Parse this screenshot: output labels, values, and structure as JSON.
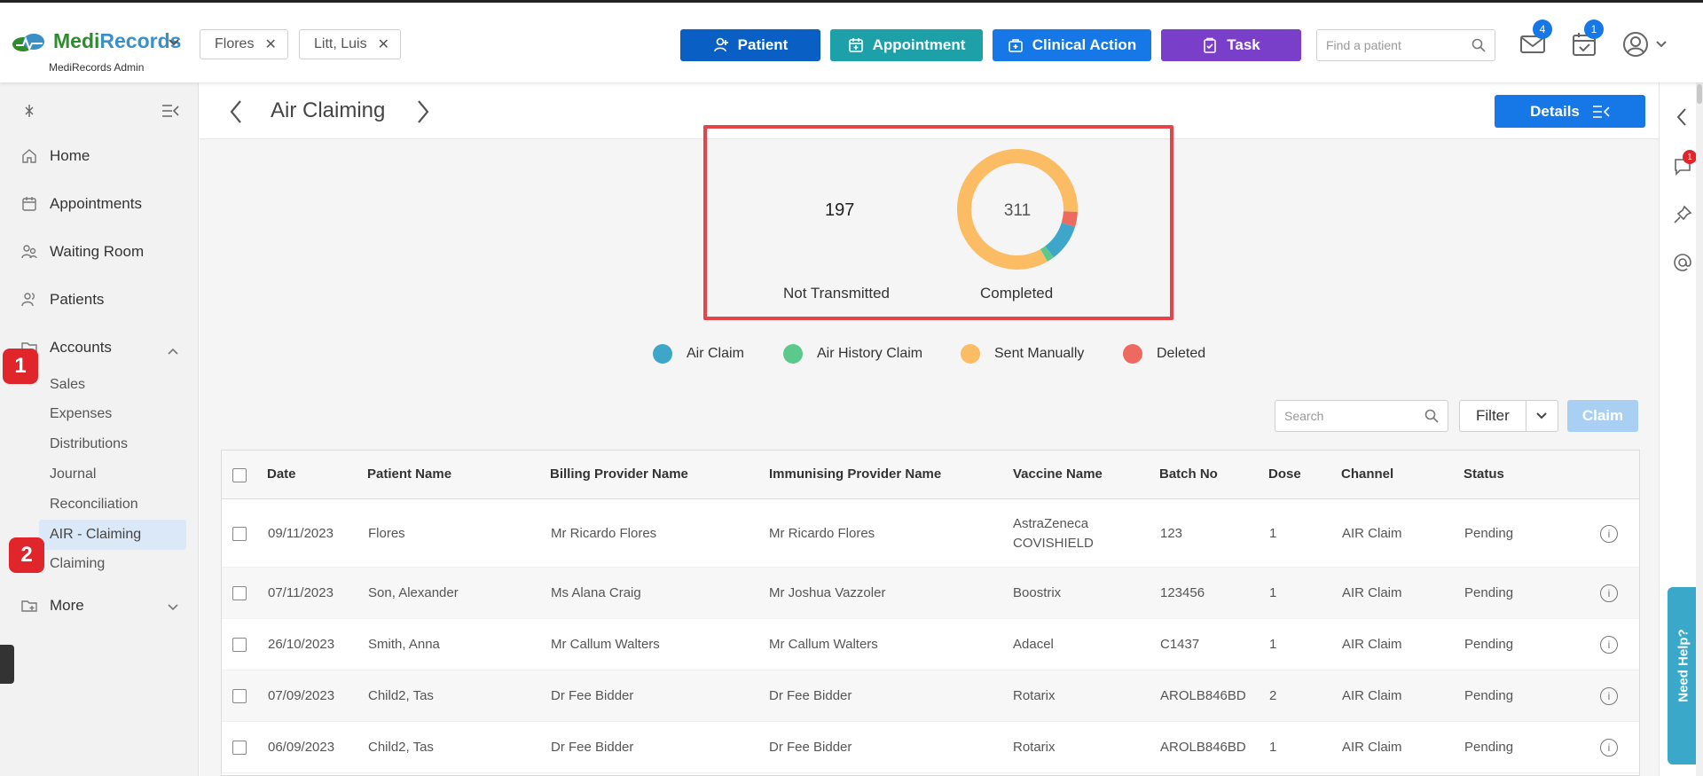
{
  "app": {
    "logo_medi": "Medi",
    "logo_records": "Records",
    "logo_sub": "MediRecords Admin"
  },
  "patient_tabs": [
    "Flores",
    "Litt, Luis"
  ],
  "actions": {
    "patient": "Patient",
    "appointment": "Appointment",
    "clinical_action": "Clinical Action",
    "task": "Task"
  },
  "colors": {
    "patient": "#0a5fc4",
    "appointment": "#1ea0a8",
    "clinical_action": "#1677e6",
    "task": "#7a3fc9",
    "marker": "#e0252b"
  },
  "find_patient_placeholder": "Find a patient",
  "badges": {
    "mail": "4",
    "tasks": "1",
    "chat": "1"
  },
  "sidebar": {
    "home": "Home",
    "appointments": "Appointments",
    "waiting_room": "Waiting Room",
    "patients": "Patients",
    "accounts": "Accounts",
    "sub": [
      "Sales",
      "Expenses",
      "Distributions",
      "Journal",
      "Reconciliation",
      "AIR - Claiming",
      "Claiming"
    ],
    "more": "More"
  },
  "markers": [
    "1",
    "2"
  ],
  "page": {
    "title": "Air Claiming",
    "details": "Details"
  },
  "stats": {
    "not_transmitted_value": "197",
    "not_transmitted_label": "Not Transmitted",
    "completed_value": "311",
    "completed_label": "Completed"
  },
  "legend": [
    {
      "label": "Air Claim",
      "color": "#3ea7c9"
    },
    {
      "label": "Air History Claim",
      "color": "#5cc98c"
    },
    {
      "label": "Sent Manually",
      "color": "#fbbc63"
    },
    {
      "label": "Deleted",
      "color": "#ee6a60"
    }
  ],
  "chart_data": {
    "type": "pie",
    "center_label": "311",
    "series": [
      {
        "name": "Sent Manually",
        "value": 0.84,
        "color": "#fbbc63"
      },
      {
        "name": "Deleted",
        "value": 0.04,
        "color": "#ee6a60"
      },
      {
        "name": "Air Claim",
        "value": 0.1,
        "color": "#3ea7c9"
      },
      {
        "name": "Air History Claim",
        "value": 0.02,
        "color": "#5cc98c"
      }
    ]
  },
  "toolbar": {
    "search_placeholder": "Search",
    "filter": "Filter",
    "claim": "Claim"
  },
  "table": {
    "headers": [
      "Date",
      "Patient Name",
      "Billing Provider Name",
      "Immunising Provider Name",
      "Vaccine Name",
      "Batch No",
      "Dose",
      "Channel",
      "Status"
    ],
    "rows": [
      {
        "date": "09/11/2023",
        "patient": "Flores",
        "billing": "Mr Ricardo Flores",
        "immunising": "Mr Ricardo Flores",
        "vaccine": "AstraZeneca",
        "vaccine2": "COVISHIELD",
        "batch": "123",
        "dose": "1",
        "channel": "AIR Claim",
        "status": "Pending"
      },
      {
        "date": "07/11/2023",
        "patient": "Son, Alexander",
        "billing": "Ms Alana Craig",
        "immunising": "Mr Joshua Vazzoler",
        "vaccine": "Boostrix",
        "vaccine2": "",
        "batch": "123456",
        "dose": "1",
        "channel": "AIR Claim",
        "status": "Pending"
      },
      {
        "date": "26/10/2023",
        "patient": "Smith, Anna",
        "billing": "Mr Callum Walters",
        "immunising": "Mr Callum Walters",
        "vaccine": "Adacel",
        "vaccine2": "",
        "batch": "C1437",
        "dose": "1",
        "channel": "AIR Claim",
        "status": "Pending"
      },
      {
        "date": "07/09/2023",
        "patient": "Child2, Tas",
        "billing": "Dr Fee Bidder",
        "immunising": "Dr Fee Bidder",
        "vaccine": "Rotarix",
        "vaccine2": "",
        "batch": "AROLB846BD",
        "dose": "2",
        "channel": "AIR Claim",
        "status": "Pending"
      },
      {
        "date": "06/09/2023",
        "patient": "Child2, Tas",
        "billing": "Dr Fee Bidder",
        "immunising": "Dr Fee Bidder",
        "vaccine": "Rotarix",
        "vaccine2": "",
        "batch": "AROLB846BD",
        "dose": "1",
        "channel": "AIR Claim",
        "status": "Pending"
      }
    ]
  },
  "help": "Need Help?"
}
